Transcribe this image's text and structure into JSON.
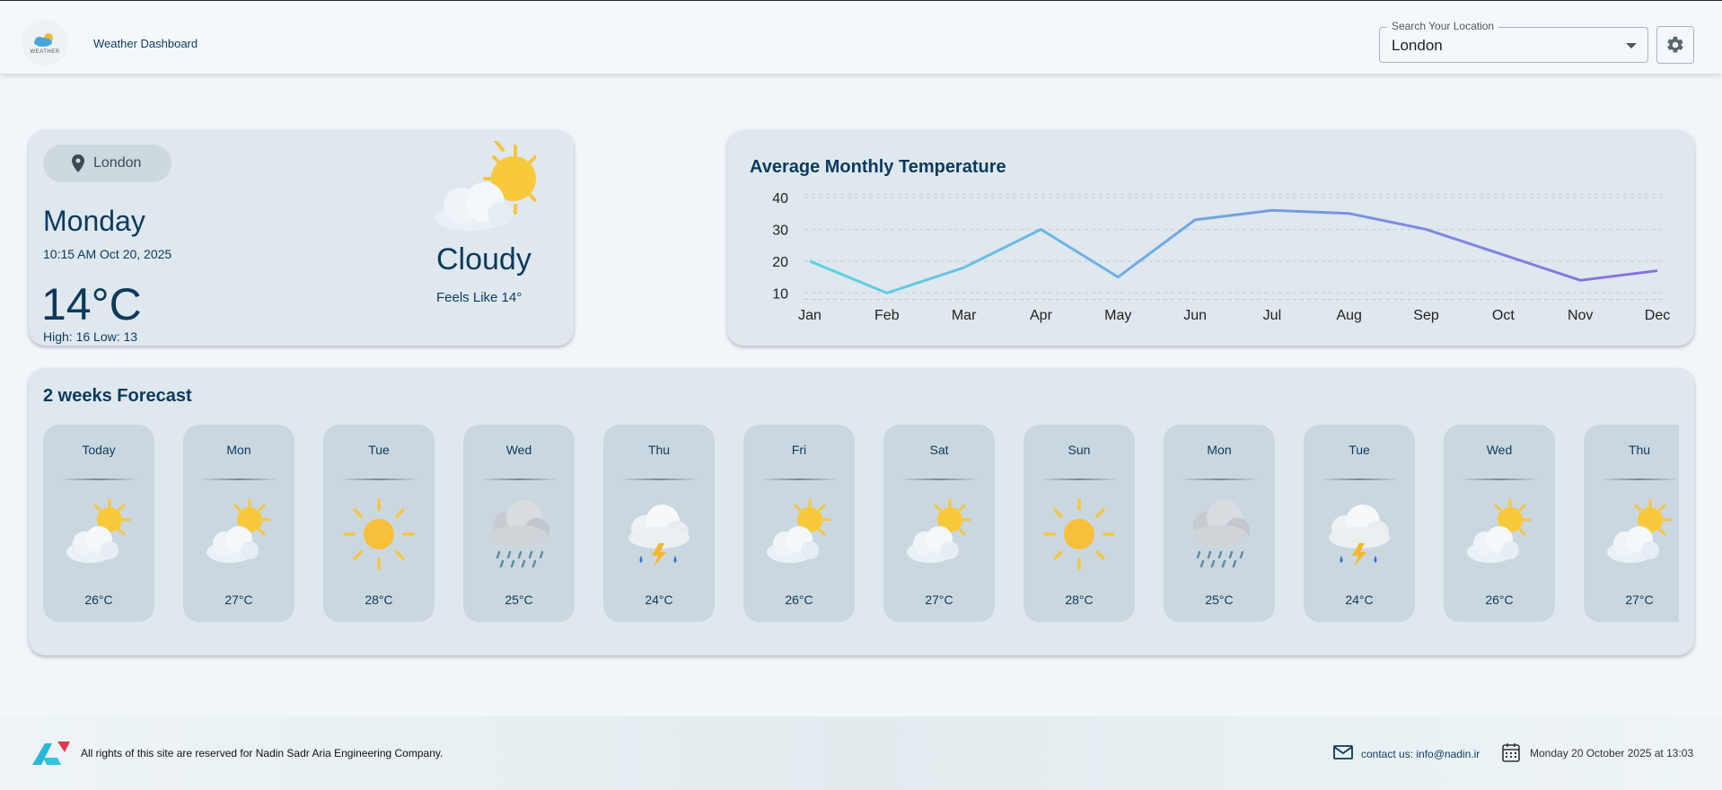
{
  "header": {
    "logo_word": "WEATHER",
    "title": "Weather Dashboard",
    "search_legend": "Search Your Location",
    "search_value": "London"
  },
  "current": {
    "location": "London",
    "day": "Monday",
    "datetime": "10:15 AM Oct 20, 2025",
    "temperature": "14°C",
    "high_low": "High: 16 Low: 13",
    "condition": "Cloudy",
    "feels_like": "Feels Like 14°",
    "condition_icon": "partly-cloudy-icon"
  },
  "chart_data": {
    "type": "line",
    "title": "Average Monthly Temperature",
    "categories": [
      "Jan",
      "Feb",
      "Mar",
      "Apr",
      "May",
      "Jun",
      "Jul",
      "Aug",
      "Sep",
      "Oct",
      "Nov",
      "Dec"
    ],
    "series": [
      {
        "values": [
          20,
          10,
          18,
          30,
          15,
          33,
          36,
          35,
          30,
          22,
          14,
          17
        ]
      }
    ],
    "yticks": [
      10,
      20,
      30,
      40
    ],
    "ylim": [
      7,
      42
    ],
    "grid": true,
    "line_gradient": [
      "#5fd3e6",
      "#8a6ee0"
    ]
  },
  "forecast": {
    "title": "2 weeks Forecast",
    "days": [
      {
        "day": "Today",
        "temp": "26°C",
        "icon": "partly-cloudy-icon"
      },
      {
        "day": "Mon",
        "temp": "27°C",
        "icon": "partly-cloudy-icon"
      },
      {
        "day": "Tue",
        "temp": "28°C",
        "icon": "sunny-icon"
      },
      {
        "day": "Wed",
        "temp": "25°C",
        "icon": "rain-cloud-icon"
      },
      {
        "day": "Thu",
        "temp": "24°C",
        "icon": "thunderstorm-icon"
      },
      {
        "day": "Fri",
        "temp": "26°C",
        "icon": "partly-cloudy-icon"
      },
      {
        "day": "Sat",
        "temp": "27°C",
        "icon": "partly-cloudy-icon"
      },
      {
        "day": "Sun",
        "temp": "28°C",
        "icon": "sunny-icon"
      },
      {
        "day": "Mon",
        "temp": "25°C",
        "icon": "rain-cloud-icon"
      },
      {
        "day": "Tue",
        "temp": "24°C",
        "icon": "thunderstorm-icon"
      },
      {
        "day": "Wed",
        "temp": "26°C",
        "icon": "partly-cloudy-icon"
      },
      {
        "day": "Thu",
        "temp": "27°C",
        "icon": "partly-cloudy-icon"
      }
    ]
  },
  "footer": {
    "rights": "All rights of this site are reserved for Nadin Sadr Aria Engineering Company.",
    "contact": "contact us: info@nadin.ir",
    "date": "Monday 20 October 2025 at 13:03"
  },
  "colors": {
    "primary_text": "#0b3a5c",
    "card_bg": "#dfe8ee",
    "tile_bg": "#cbd7df",
    "page_bg": "#f1f6fb"
  }
}
